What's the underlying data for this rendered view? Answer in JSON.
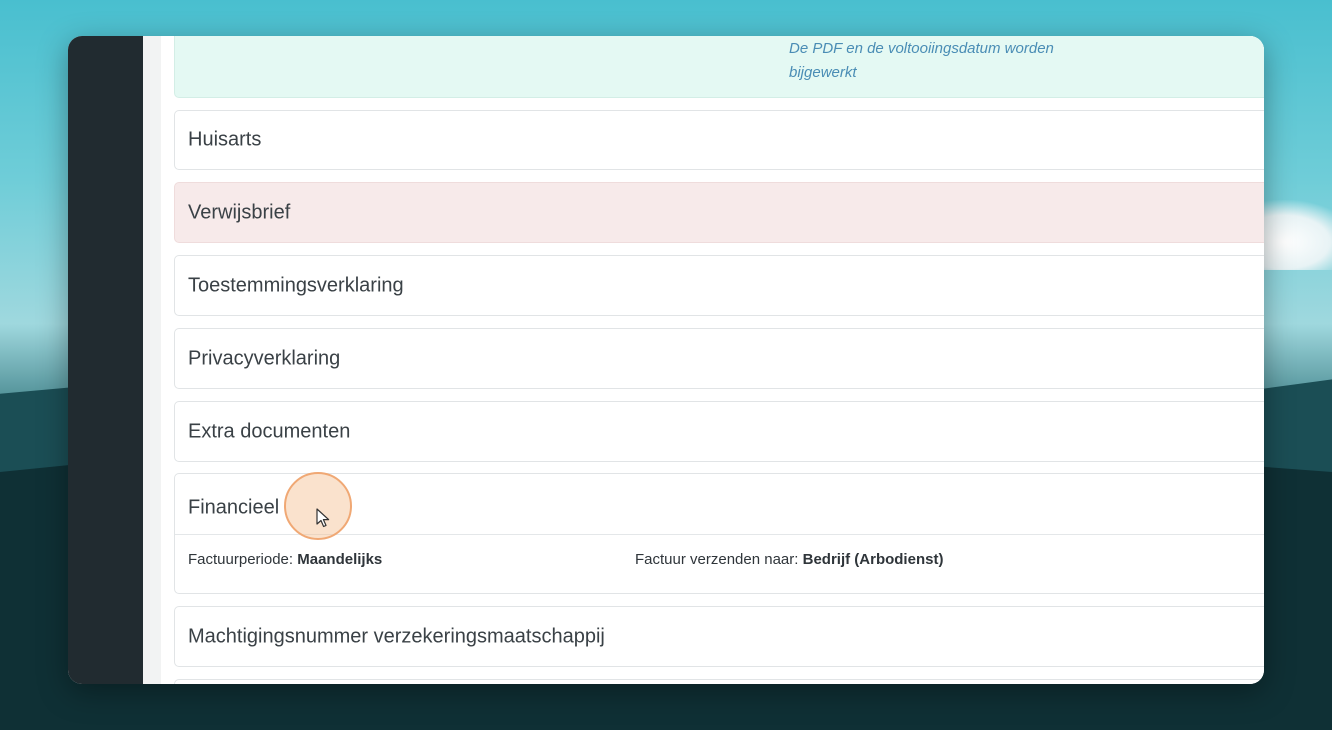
{
  "notice": {
    "line_clipped": "…… …… … … …… ……",
    "line_1": "De PDF en de voltooiingsdatum worden",
    "line_2": "bijgewerkt"
  },
  "sections": {
    "huisarts": "Huisarts",
    "verwijsbrief": "Verwijsbrief",
    "toestemmingsverklaring": "Toestemmingsverklaring",
    "privacyverklaring": "Privacyverklaring",
    "extra_documenten": "Extra documenten",
    "financieel": "Financieel",
    "machtigingsnummer": "Machtigingsnummer verzekeringsmaatschappij"
  },
  "financieel": {
    "factuurperiode_label": "Factuurperiode:",
    "factuurperiode_value": "Maandelijks",
    "verzenden_label": "Factuur verzenden naar:",
    "verzenden_value": "Bedrijf (Arbodienst)"
  },
  "colors": {
    "success_bg": "#e4f9f3",
    "warning_bg": "#f7eaea",
    "sidebar": "#212b30",
    "cursor_highlight": "#f0a874"
  },
  "icons": {
    "cursor": "mouse-pointer-icon"
  }
}
